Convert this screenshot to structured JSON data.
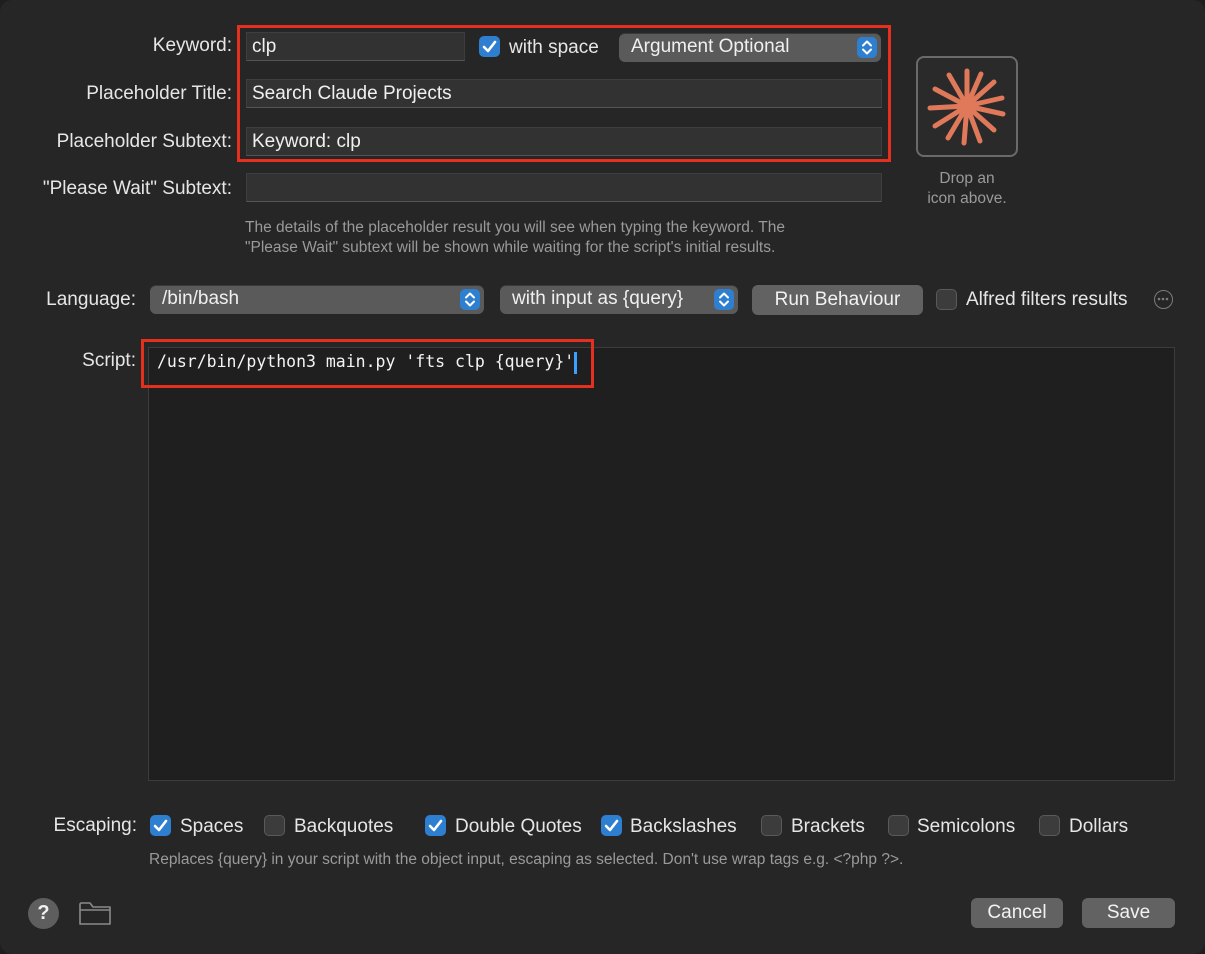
{
  "keyword": {
    "label": "Keyword:",
    "value": "clp",
    "with_space_label": "with space",
    "with_space_checked": true,
    "argument_mode": "Argument Optional"
  },
  "placeholder_title": {
    "label": "Placeholder Title:",
    "value": "Search Claude Projects"
  },
  "placeholder_subtext": {
    "label": "Placeholder Subtext:",
    "value": "Keyword: clp"
  },
  "please_wait_subtext": {
    "label": "\"Please Wait\" Subtext:",
    "value": ""
  },
  "placeholder_hint": [
    "The details of the placeholder result you will see when typing the keyword. The",
    "\"Please Wait\" subtext will be shown while waiting for the script's initial results."
  ],
  "icon_well": {
    "caption_line1": "Drop an",
    "caption_line2": "icon above.",
    "icon": "claude-starburst-icon",
    "icon_color": "#e0795a"
  },
  "language": {
    "label": "Language:",
    "value": "/bin/bash",
    "input_mode": "with input as {query}",
    "run_behaviour_label": "Run Behaviour",
    "alfred_filters_label": "Alfred filters results",
    "alfred_filters_checked": false
  },
  "script": {
    "label": "Script:",
    "content": "/usr/bin/python3 main.py 'fts clp {query}'"
  },
  "escaping": {
    "label": "Escaping:",
    "options": [
      {
        "label": "Spaces",
        "checked": true
      },
      {
        "label": "Backquotes",
        "checked": false
      },
      {
        "label": "Double Quotes",
        "checked": true
      },
      {
        "label": "Backslashes",
        "checked": true
      },
      {
        "label": "Brackets",
        "checked": false
      },
      {
        "label": "Semicolons",
        "checked": false
      },
      {
        "label": "Dollars",
        "checked": false
      }
    ],
    "hint": "Replaces {query} in your script with the object input, escaping as selected. Don't use wrap tags e.g. <?php ?>."
  },
  "footer": {
    "help_label": "?",
    "cancel_label": "Cancel",
    "save_label": "Save"
  },
  "colors": {
    "accent": "#2f7fd0",
    "highlight_box": "#e5301f",
    "background": "#262626"
  }
}
